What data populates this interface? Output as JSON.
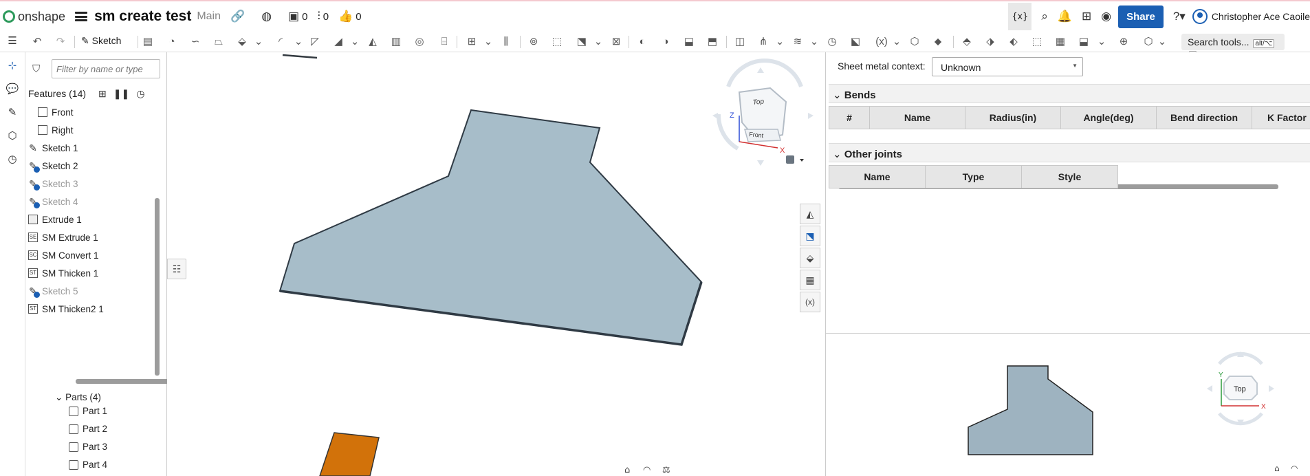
{
  "app": {
    "logo_text": "onshape"
  },
  "document": {
    "title": "sm create test",
    "branch": "Main"
  },
  "topbar": {
    "versions_count": "0",
    "branches_count": "0",
    "likes_count": "0",
    "variables_label": "{x}",
    "share_label": "Share",
    "user_name": "Christopher Ace Caoile"
  },
  "toolbar": {
    "sketch_label": "Sketch",
    "search_label": "Search tools...",
    "search_shortcut_1": "alt/⌥",
    "search_shortcut_2": "c"
  },
  "features": {
    "filter_placeholder": "Filter by name or type",
    "header": "Features (14)",
    "items": [
      {
        "label": "Front",
        "type": "plane",
        "muted": false
      },
      {
        "label": "Right",
        "type": "plane",
        "muted": false
      },
      {
        "label": "Sketch 1",
        "type": "sketch",
        "muted": false
      },
      {
        "label": "Sketch 2",
        "type": "sketch-hidden",
        "muted": false
      },
      {
        "label": "Sketch 3",
        "type": "sketch-hidden",
        "muted": true
      },
      {
        "label": "Sketch 4",
        "type": "sketch-hidden",
        "muted": true
      },
      {
        "label": "Extrude 1",
        "type": "extrude",
        "muted": false
      },
      {
        "label": "SM Extrude 1",
        "type": "SE",
        "muted": false
      },
      {
        "label": "SM Convert 1",
        "type": "SC",
        "muted": false
      },
      {
        "label": "SM Thicken 1",
        "type": "ST",
        "muted": false
      },
      {
        "label": "Sketch 5",
        "type": "sketch-hidden",
        "muted": true
      },
      {
        "label": "SM Thicken2 1",
        "type": "ST",
        "muted": false
      }
    ],
    "parts_header": "Parts (4)",
    "parts": [
      "Part 1",
      "Part 2",
      "Part 3",
      "Part 4"
    ]
  },
  "viewcube": {
    "top_label": "Top",
    "front_label": "Front",
    "x_label": "X",
    "z_label": "Z",
    "y_label": "Y"
  },
  "sheet_metal": {
    "context_label": "Sheet metal context:",
    "context_value": "Unknown",
    "bends_header": "Bends",
    "bends_columns": [
      "#",
      "Name",
      "Radius(in)",
      "Angle(deg)",
      "Bend direction",
      "K Factor"
    ],
    "joints_header": "Other joints",
    "joints_columns": [
      "Name",
      "Type",
      "Style"
    ]
  },
  "colors": {
    "part_fill": "#a7bdc9",
    "part_edge": "#333a40",
    "orange_part": "#d2720a",
    "accent": "#1b5fb3"
  }
}
